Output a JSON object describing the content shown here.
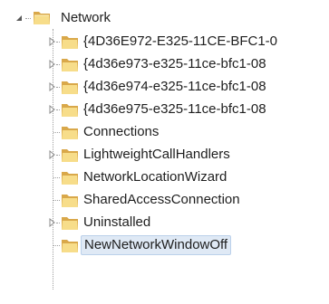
{
  "tree": {
    "root": {
      "label": "Network",
      "expanded": true,
      "icon": "folder-icon"
    },
    "children": [
      {
        "label": "{4D36E972-E325-11CE-BFC1-0",
        "expandable": true,
        "icon": "folder-icon"
      },
      {
        "label": "{4d36e973-e325-11ce-bfc1-08",
        "expandable": true,
        "icon": "folder-icon"
      },
      {
        "label": "{4d36e974-e325-11ce-bfc1-08",
        "expandable": true,
        "icon": "folder-icon"
      },
      {
        "label": "{4d36e975-e325-11ce-bfc1-08",
        "expandable": true,
        "icon": "folder-icon"
      },
      {
        "label": "Connections",
        "expandable": false,
        "icon": "folder-icon"
      },
      {
        "label": "LightweightCallHandlers",
        "expandable": true,
        "icon": "folder-icon"
      },
      {
        "label": "NetworkLocationWizard",
        "expandable": false,
        "icon": "folder-icon"
      },
      {
        "label": "SharedAccessConnection",
        "expandable": false,
        "icon": "folder-icon"
      },
      {
        "label": "Uninstalled",
        "expandable": true,
        "icon": "folder-icon"
      },
      {
        "label": "NewNetworkWindowOff",
        "expandable": false,
        "selected": true,
        "icon": "folder-icon"
      }
    ]
  },
  "colors": {
    "selection_background": "#dfe9f5",
    "selection_border": "#bad0ea",
    "folder_light": "#f7dd8a",
    "folder_dark": "#d9a84a",
    "tree_lines": "#a0a0a0"
  }
}
